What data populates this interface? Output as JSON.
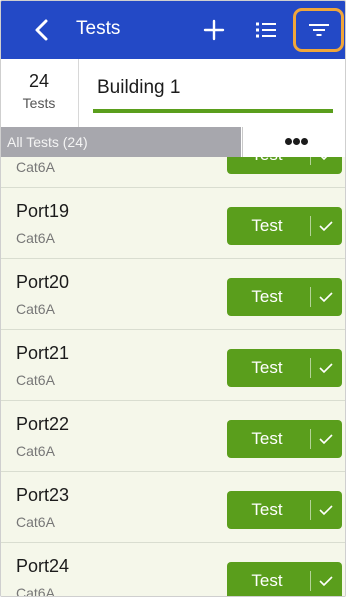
{
  "header": {
    "title": "Tests",
    "accent_color": "#2349c6",
    "icons": {
      "back": "chevron-left-icon",
      "add": "plus-icon",
      "list": "list-icon",
      "filter": "filter-icon"
    },
    "highlight_color": "#f0a63a"
  },
  "summary": {
    "count": "24",
    "count_label": "Tests",
    "building": "Building 1",
    "progress_fraction": 1.0,
    "progress_color": "#5a9e1c"
  },
  "filterbar": {
    "all_tests_label": "All Tests (24)",
    "more_icon": "more-horizontal-icon"
  },
  "list": {
    "button_color": "#5a9e1c",
    "rows": [
      {
        "name": "",
        "type": "Cat6A",
        "button": "Test"
      },
      {
        "name": "Port19",
        "type": "Cat6A",
        "button": "Test"
      },
      {
        "name": "Port20",
        "type": "Cat6A",
        "button": "Test"
      },
      {
        "name": "Port21",
        "type": "Cat6A",
        "button": "Test"
      },
      {
        "name": "Port22",
        "type": "Cat6A",
        "button": "Test"
      },
      {
        "name": "Port23",
        "type": "Cat6A",
        "button": "Test"
      },
      {
        "name": "Port24",
        "type": "Cat6A",
        "button": "Test"
      }
    ]
  }
}
